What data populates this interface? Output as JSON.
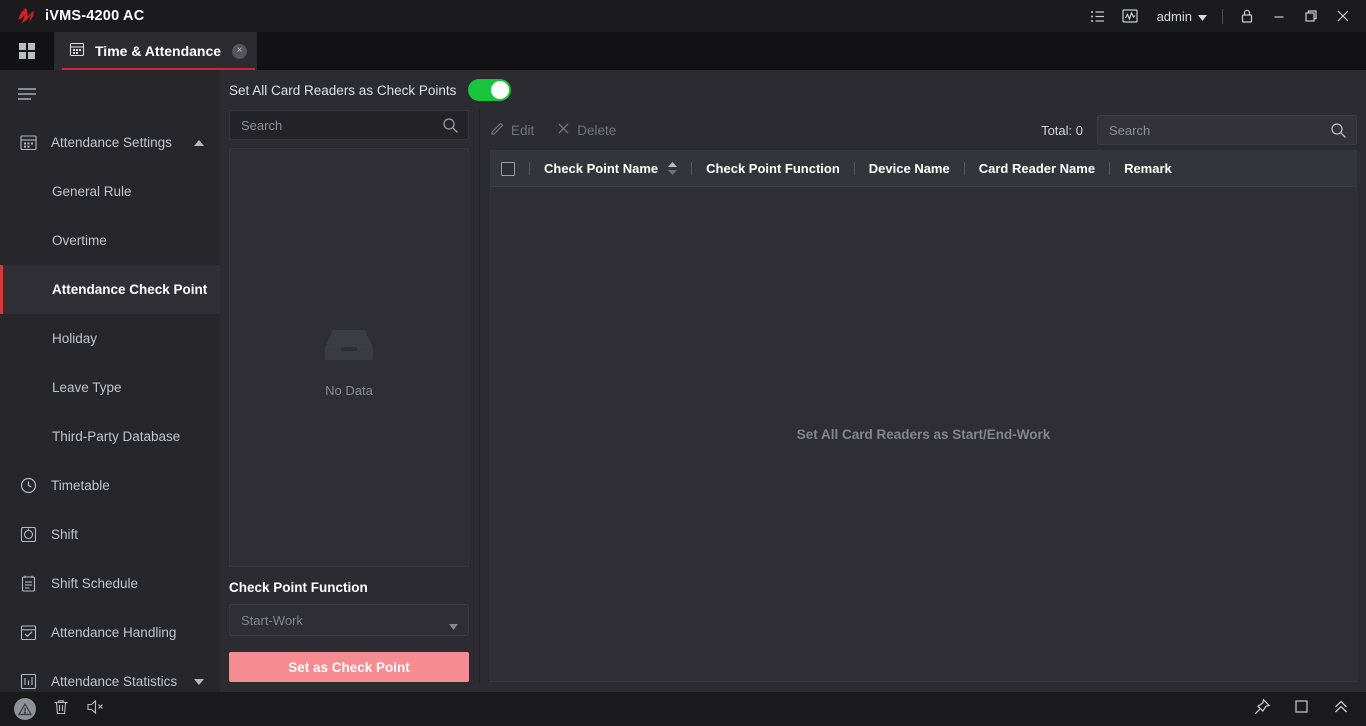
{
  "app": {
    "title": "iVMS-4200 AC",
    "logo_icon": "hikvision-logo-icon"
  },
  "titlebar": {
    "list_icon": "list-icon",
    "chart_icon": "chart-icon",
    "user_label": "admin",
    "user_caret_icon": "chevron-down-icon",
    "lock_icon": "lock-icon",
    "minimize_icon": "minimize-icon",
    "maximize_icon": "maximize-icon",
    "close_icon": "close-icon"
  },
  "tabbar": {
    "apps_icon": "grid-apps-icon",
    "tab": {
      "icon": "calendar-icon",
      "label": "Time & Attendance",
      "close_label": "×"
    },
    "accent_color": "#c8292f"
  },
  "sidebar": {
    "menu_icon": "hamburger-icon",
    "groups": [
      {
        "label": "Attendance Settings",
        "icon": "calendar-icon",
        "caret_icon": "chevron-up-icon",
        "expanded": true,
        "items": [
          {
            "label": "General Rule",
            "active": false
          },
          {
            "label": "Overtime",
            "active": false
          },
          {
            "label": "Attendance Check Point",
            "active": true
          },
          {
            "label": "Holiday",
            "active": false
          },
          {
            "label": "Leave Type",
            "active": false
          },
          {
            "label": "Third-Party Database",
            "active": false
          }
        ]
      }
    ],
    "items": [
      {
        "label": "Timetable",
        "icon": "clock-icon"
      },
      {
        "label": "Shift",
        "icon": "shift-icon"
      },
      {
        "label": "Shift Schedule",
        "icon": "schedule-icon"
      },
      {
        "label": "Attendance Handling",
        "icon": "check-calendar-icon"
      },
      {
        "label": "Attendance Statistics",
        "icon": "statistics-icon",
        "caret_icon": "chevron-down-icon"
      }
    ],
    "active_marker_color": "#d4373d"
  },
  "content": {
    "toggle": {
      "label": "Set All Card Readers as Check Points",
      "state": "on",
      "on_color": "#19c33c"
    },
    "left_pane": {
      "search_placeholder": "Search",
      "search_icon": "search-icon",
      "empty_icon": "empty-box-icon",
      "empty_text": "No Data",
      "function_label": "Check Point Function",
      "function_value": "Start-Work",
      "function_caret_icon": "chevron-down-icon",
      "primary_button": "Set as Check Point",
      "primary_button_color": "#f58c91"
    },
    "right_pane": {
      "toolbar": {
        "edit_label": "Edit",
        "edit_icon": "edit-icon",
        "edit_enabled": false,
        "delete_label": "Delete",
        "delete_icon": "close-x-icon",
        "delete_enabled": false,
        "total_label": "Total: 0",
        "search_placeholder": "Search",
        "search_icon": "search-icon"
      },
      "table": {
        "select_all_checked": false,
        "columns": [
          "Check Point Name",
          "Check Point Function",
          "Device Name",
          "Card Reader Name",
          "Remark"
        ],
        "sort_icon": "sort-arrows-icon",
        "rows": [],
        "empty_message": "Set All Card Readers as Start/End-Work"
      }
    }
  },
  "statusbar": {
    "warning_icon": "warning-icon",
    "trash_icon": "trash-icon",
    "mute_icon": "speaker-mute-icon",
    "pin_icon": "pin-icon",
    "window_icon": "square-window-icon",
    "expand_icon": "double-chevron-up-icon"
  }
}
